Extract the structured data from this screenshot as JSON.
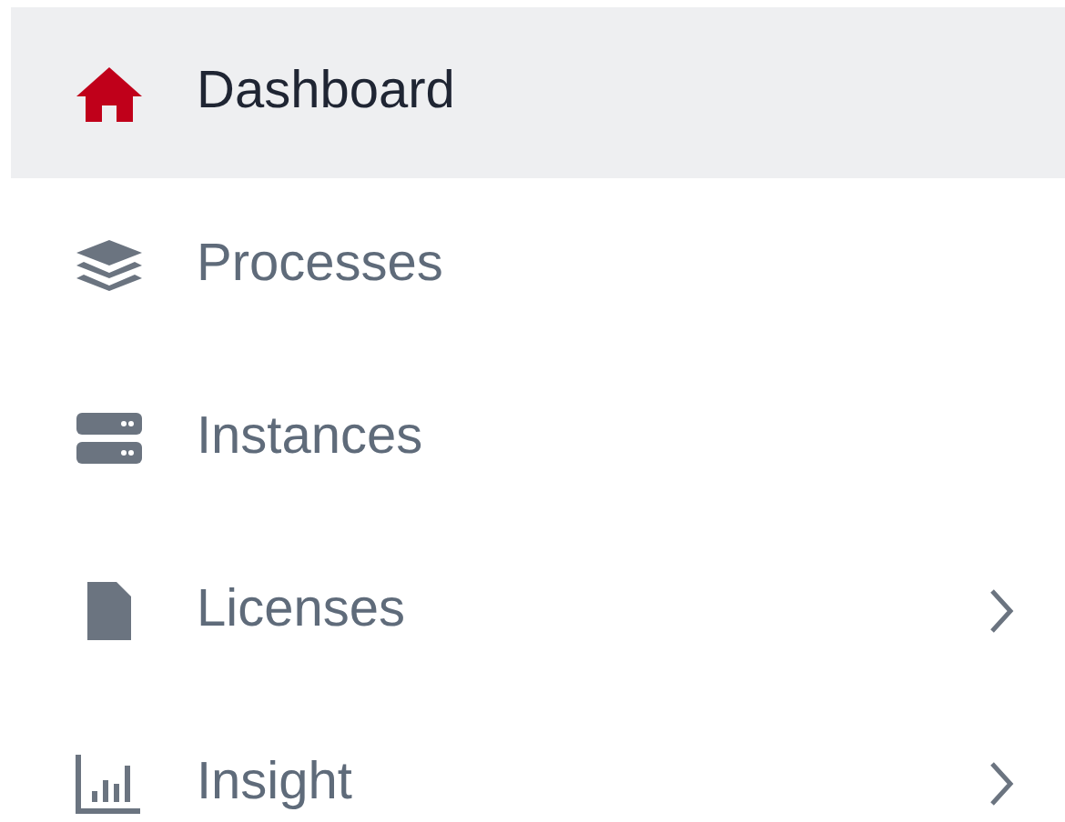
{
  "sidebar": {
    "items": [
      {
        "label": "Dashboard",
        "selected": true,
        "has_submenu": false
      },
      {
        "label": "Processes",
        "selected": false,
        "has_submenu": false
      },
      {
        "label": "Instances",
        "selected": false,
        "has_submenu": false
      },
      {
        "label": "Licenses",
        "selected": false,
        "has_submenu": true
      },
      {
        "label": "Insight",
        "selected": false,
        "has_submenu": true
      }
    ]
  }
}
